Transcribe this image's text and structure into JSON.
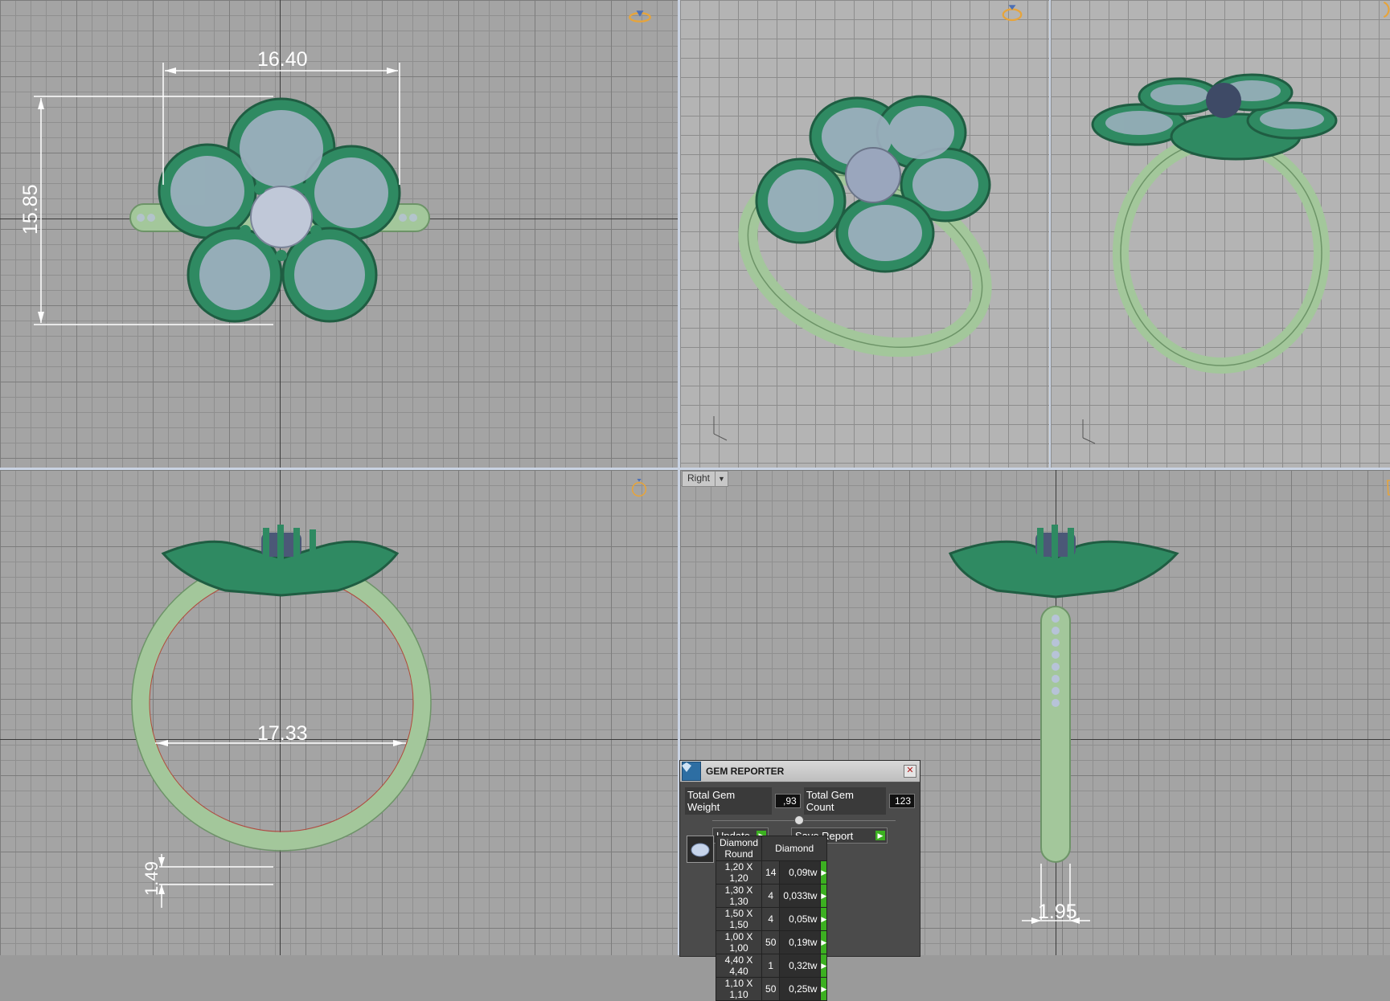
{
  "dimensions": {
    "top_width": "16.40",
    "top_height": "15.85",
    "front_inner_diameter": "17.33",
    "front_shank_thickness": "1.49",
    "side_shank_width": "1.95"
  },
  "viewports": {
    "bottom_right_label": "Right"
  },
  "gem_reporter": {
    "title": "GEM REPORTER",
    "total_weight_label": "Total Gem Weight",
    "total_weight_value": ",93",
    "total_count_label": "Total Gem Count",
    "total_count_value": "123",
    "update_label": "Update",
    "save_report_label": "Save Report",
    "table_headers": [
      "Diamond Round",
      "Diamond"
    ],
    "rows": [
      {
        "size": "1,20 X 1,20",
        "count": "14",
        "weight": "0,09tw"
      },
      {
        "size": "1,30 X 1,30",
        "count": "4",
        "weight": "0,033tw"
      },
      {
        "size": "1,50 X 1,50",
        "count": "4",
        "weight": "0,05tw"
      },
      {
        "size": "1,00 X 1,00",
        "count": "50",
        "weight": "0,19tw"
      },
      {
        "size": "4,40 X 4,40",
        "count": "1",
        "weight": "0,32tw"
      },
      {
        "size": "1,10 X 1,10",
        "count": "50",
        "weight": "0,25tw"
      }
    ]
  },
  "colors": {
    "metal_green": "#2f8a62",
    "shank_green": "#a8cfa0",
    "gem": "#b8c4d6",
    "accent_orange": "#e7a43a"
  }
}
